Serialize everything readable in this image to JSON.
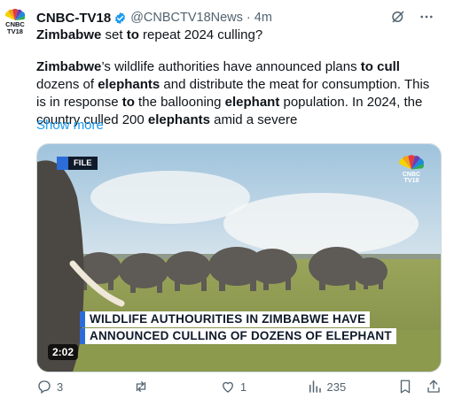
{
  "account": {
    "avatar_line1": "CNBC",
    "avatar_line2": "TV18",
    "name": "CNBC-TV18",
    "handle": "@CNBCTV18News",
    "separator": "·",
    "time": "4m"
  },
  "tweet": {
    "title_segments": [
      {
        "text": "Zimbabwe",
        "bold": true
      },
      {
        "text": " set ",
        "bold": false
      },
      {
        "text": "to",
        "bold": true
      },
      {
        "text": " repeat 2024 culling?",
        "bold": false
      }
    ],
    "body_segments": [
      {
        "text": "Zimbabwe",
        "bold": true
      },
      {
        "text": "’s wildlife authorities have announced plans ",
        "bold": false
      },
      {
        "text": "to cull",
        "bold": true
      },
      {
        "text": " dozens of ",
        "bold": false
      },
      {
        "text": "elephants",
        "bold": true
      },
      {
        "text": " and distribute the meat for consumption. This is in response ",
        "bold": false
      },
      {
        "text": "to",
        "bold": true
      },
      {
        "text": " the ballooning ",
        "bold": false
      },
      {
        "text": "elephant",
        "bold": true
      },
      {
        "text": " population. In 2024, the country culled 200 ",
        "bold": false
      },
      {
        "text": "elephants",
        "bold": true
      },
      {
        "text": " amid a severe",
        "bold": false
      }
    ],
    "show_more": "Show more"
  },
  "media": {
    "tag": "FILE",
    "logo_line1": "CNBC",
    "logo_line2": "TV18",
    "caption_line1": "WILDLIFE AUTHOURITIES IN ZIMBABWE HAVE",
    "caption_line2": "ANNOUNCED CULLING OF DOZENS OF ELEPHANT",
    "duration": "2:02"
  },
  "actions": {
    "replies": "3",
    "reposts": "",
    "likes": "1",
    "views": "235"
  },
  "icons": {
    "verified": "verified-badge-icon",
    "grok": "grok-icon",
    "more": "more-icon",
    "reply": "reply-icon",
    "repost": "repost-icon",
    "like": "like-icon",
    "views": "views-icon",
    "bookmark": "bookmark-icon",
    "share": "share-icon"
  },
  "colors": {
    "link": "#1d9bf0",
    "verified": "#1d9bf0",
    "muted": "#536471",
    "caption_accent": "#2b6cd8"
  }
}
